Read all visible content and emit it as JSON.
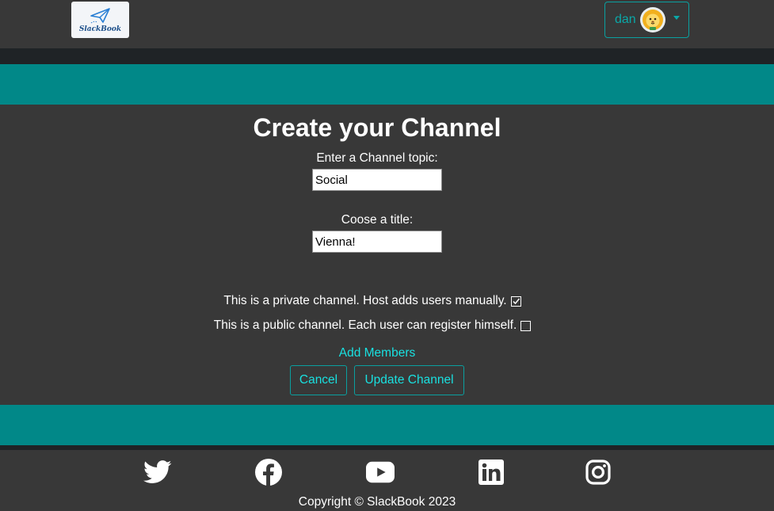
{
  "navbar": {
    "logo_text": "SlackBook",
    "user_name": "dan"
  },
  "form": {
    "title": "Create your Channel",
    "topic_label": "Enter a Channel topic:",
    "topic_value": "Social",
    "title_label": "Coose a title:",
    "title_value": "Vienna!",
    "private_option": "This is a private channel. Host adds users manually.",
    "private_checked": true,
    "public_option": "This is a public channel. Each user can register himself.",
    "public_checked": false,
    "add_members": "Add Members",
    "cancel": "Cancel",
    "update": "Update Channel"
  },
  "footer": {
    "social_icons": [
      "twitter-icon",
      "facebook-icon",
      "youtube-icon",
      "linkedin-icon",
      "instagram-icon"
    ],
    "copyright": "Copyright © SlackBook 2023"
  },
  "colors": {
    "background": "#383838",
    "teal_band": "#018888",
    "dark_strip": "#1f2326",
    "accent": "#19e0e0"
  }
}
